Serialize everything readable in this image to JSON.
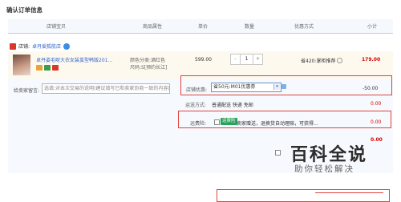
{
  "page_title": "确认订单信息",
  "table_headers": {
    "store_item": "店铺宝贝",
    "attributes": "商品属性",
    "unit_price": "单价",
    "quantity": "数量",
    "discount": "优惠方式",
    "subtotal": "小计"
  },
  "store": {
    "label": "店铺:",
    "name": "卓丹爱狐航店"
  },
  "item": {
    "name": "卓丹姿毛呢大衣女装茧型韩版201...",
    "attr_color": "颜色分类:酒红色",
    "attr_size": "尺码:S[预约长江]",
    "price": "599.00",
    "quantity": "1",
    "minus": "-",
    "plus": "+",
    "promo": "省420:掌柜推荐",
    "subtotal": "179.00"
  },
  "message": {
    "label": "给卖家留言:",
    "placeholder": "选填:对本次交易的说明(建议填写已和卖家协商一致的内容)"
  },
  "coupon": {
    "label": "店铺优惠:",
    "selected": "省50元:M01优惠券",
    "arrow": "▾",
    "amount": "-50.00"
  },
  "shipping": {
    "label": "运送方式:",
    "value": "普通配送 快递 免邮",
    "price": "0.00"
  },
  "insurance": {
    "label": "运费险:",
    "badge": "运费险",
    "text": "卖家赠送，退换货自动理赔，可获得...",
    "price": "0.00"
  },
  "store_total": {
    "price": "0.00"
  },
  "watermark": {
    "title": "百科全说",
    "subtitle": "助你轻松解决"
  },
  "colors": {
    "accent_red": "#d40000",
    "highlight_red": "#e0443e",
    "link_blue": "#3366cc",
    "header_bg": "#f5f8fd"
  }
}
